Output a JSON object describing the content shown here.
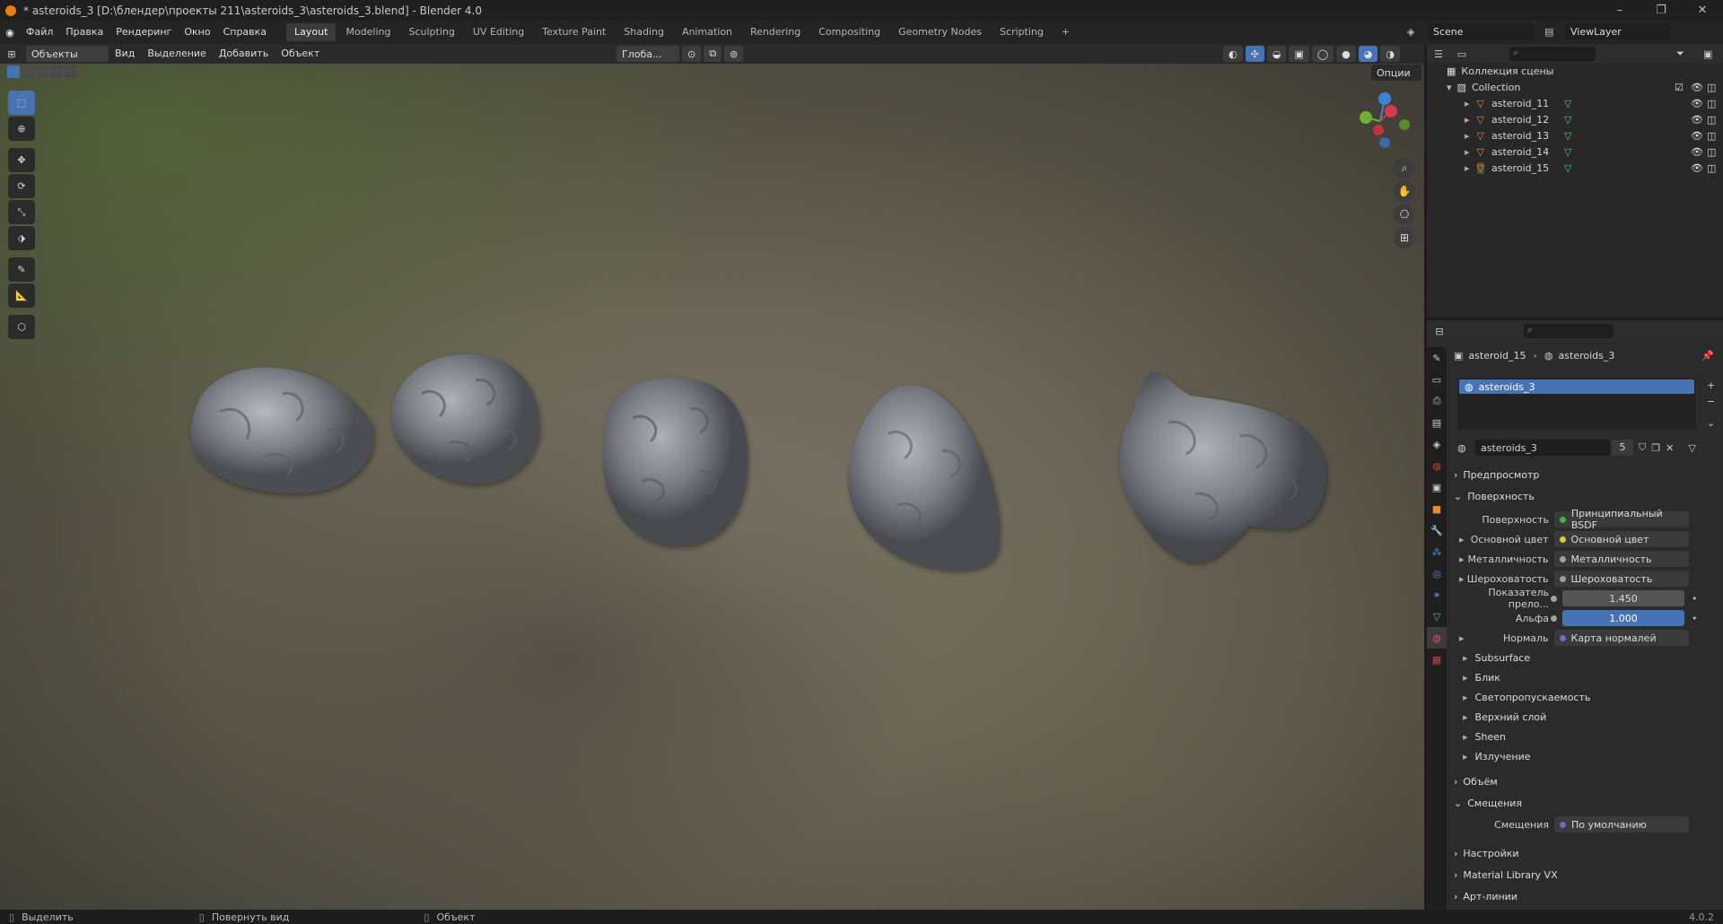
{
  "window": {
    "title": "* asteroids_3 [D:\\блендер\\проекты 211\\asteroids_3\\asteroids_3.blend] - Blender 4.0",
    "minimize": "–",
    "restore": "❐",
    "close": "✕"
  },
  "menu": {
    "items": [
      "Файл",
      "Правка",
      "Рендеринг",
      "Окно",
      "Справка"
    ]
  },
  "workspaces": [
    "Layout",
    "Modeling",
    "Sculpting",
    "UV Editing",
    "Texture Paint",
    "Shading",
    "Animation",
    "Rendering",
    "Compositing",
    "Geometry Nodes",
    "Scripting"
  ],
  "add_workspace": "+",
  "scene": {
    "label": "Scene",
    "view_layer": "ViewLayer"
  },
  "viewport_header": {
    "mode": "Объекты",
    "menus": [
      "Вид",
      "Выделение",
      "Добавить",
      "Объект"
    ],
    "orientation": "Глоба...",
    "options": "Опции"
  },
  "outliner": {
    "root": "Коллекция сцены",
    "collection": "Collection",
    "objects": [
      "asteroid_11",
      "asteroid_12",
      "asteroid_13",
      "asteroid_14",
      "asteroid_15"
    ]
  },
  "properties": {
    "breadcrumb": {
      "object": "asteroid_15",
      "material": "asteroids_3"
    },
    "slot": "asteroids_3",
    "material_name": "asteroids_3",
    "users": "5",
    "sections": {
      "preview": "Предпросмотр",
      "surface": "Поверхность",
      "volume": "Объём",
      "displacement": "Смещения",
      "settings": "Настройки",
      "library": "Material Library VX",
      "lineart": "Арт-линии"
    },
    "surface_rows": [
      {
        "label": "Поверхность",
        "value": "Принципиальный BSDF",
        "dot": "#3fb34a"
      },
      {
        "label": "Основной цвет",
        "value": "Основной цвет",
        "dot": "#d6c94a"
      },
      {
        "label": "Металличность",
        "value": "Металличность",
        "dot": "#a0a0a0"
      },
      {
        "label": "Шероховатость",
        "value": "Шероховатость",
        "dot": "#a0a0a0"
      },
      {
        "label": "Показатель прело...",
        "value": "1.450",
        "dot": "#a0a0a0"
      },
      {
        "label": "Альфа",
        "value": "1.000",
        "dot": "#a0a0a0"
      },
      {
        "label": "Нормаль",
        "value": "Карта нормалей",
        "dot": "#6f6ac9"
      }
    ],
    "subsections": [
      "Subsurface",
      "Блик",
      "Светопропускаемость",
      "Верхний слой",
      "Sheen",
      "Излучение"
    ],
    "displacement_row": {
      "label": "Смещения",
      "value": "По умолчанию"
    }
  },
  "statusbar": {
    "select": "Выделить",
    "rotate": "Повернуть вид",
    "object": "Объект",
    "version": "4.0.2"
  }
}
